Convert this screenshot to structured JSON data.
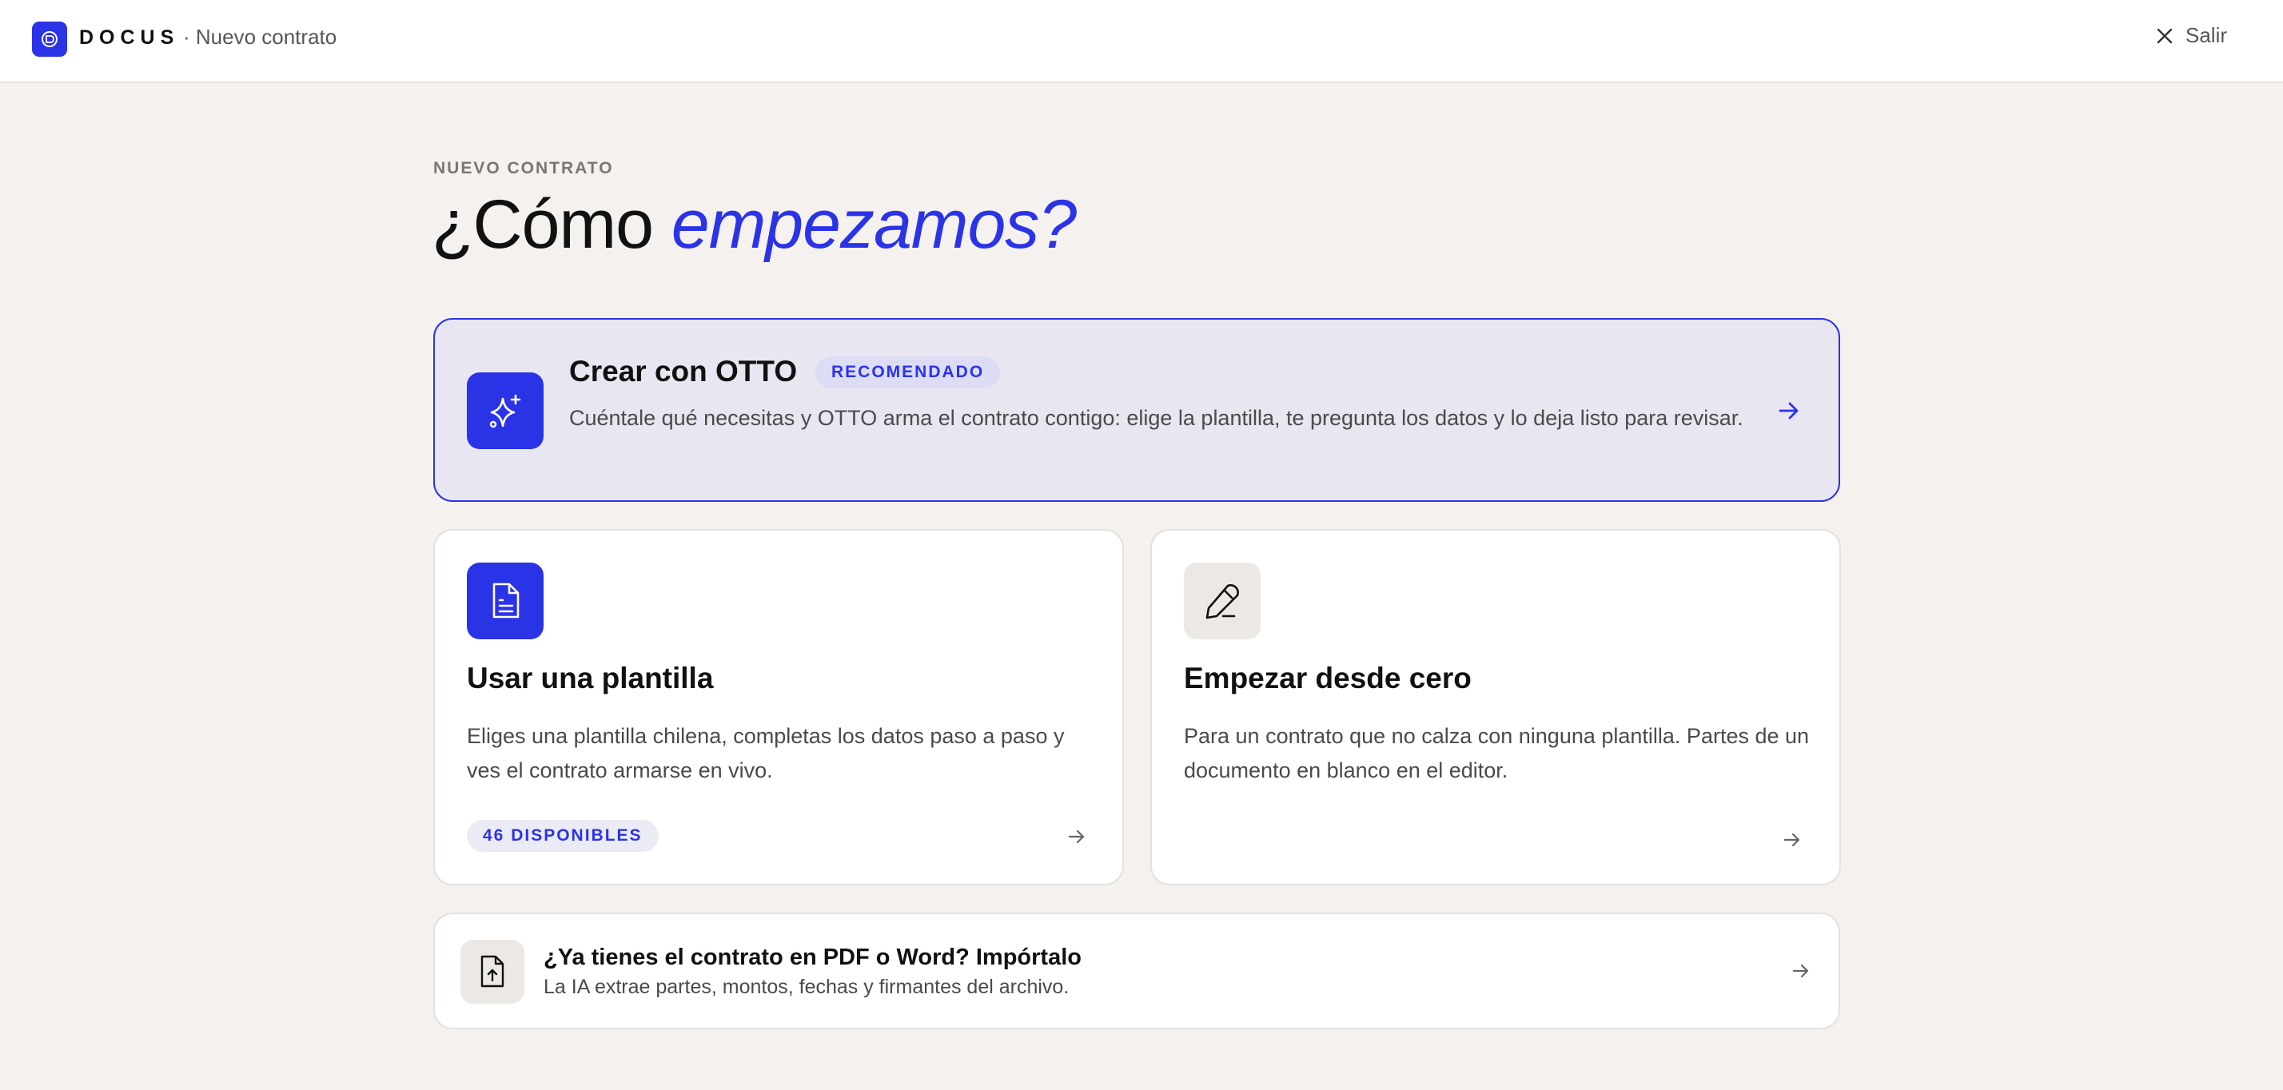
{
  "app": {
    "brand": "DOCUS",
    "breadcrumb": "· Nuevo contrato",
    "exit_label": "Salir",
    "accent_color": "#2b33e6"
  },
  "header": {
    "eyebrow": "NUEVO CONTRATO",
    "title_plain": "¿Cómo ",
    "title_accent": "empezamos?"
  },
  "options": {
    "otto": {
      "title": "Crear con OTTO",
      "badge": "RECOMENDADO",
      "description": "Cuéntale qué necesitas y OTTO arma el contrato contigo: elige la plantilla, te pregunta los datos y lo deja listo para revisar.",
      "icon": "sparkles-icon"
    },
    "template": {
      "title": "Usar una plantilla",
      "description": "Eliges una plantilla chilena, completas los datos paso a paso y ves el contrato armarse en vivo.",
      "badge": "46 DISPONIBLES",
      "icon": "document-icon"
    },
    "blank": {
      "title": "Empezar desde cero",
      "description": "Para un contrato que no calza con ninguna plantilla. Partes de un documento en blanco en el editor.",
      "icon": "pencil-icon"
    },
    "import": {
      "title": "¿Ya tienes el contrato en PDF o Word? Impórtalo",
      "description": "La IA extrae partes, montos, fechas y firmantes del archivo.",
      "icon": "file-upload-icon"
    }
  }
}
